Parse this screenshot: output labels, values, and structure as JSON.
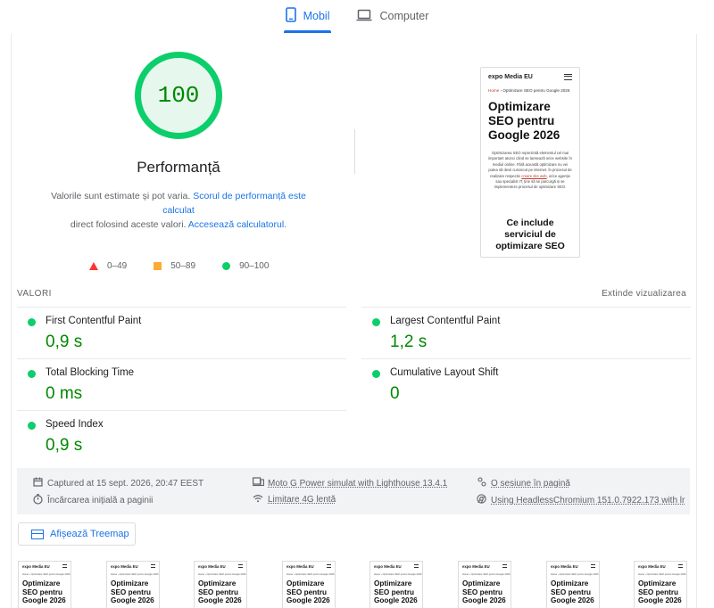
{
  "tabs": [
    {
      "label": "Mobil",
      "icon": "phone-icon",
      "active": true
    },
    {
      "label": "Computer",
      "icon": "laptop-icon",
      "active": false
    }
  ],
  "gauge": {
    "score": "100",
    "title": "Performanță",
    "note_prefix": "Valorile sunt estimate și pot varia.",
    "note_link1": "Scorul de performanță este calculat",
    "note_mid": "direct folosind aceste valori.",
    "note_link2": "Accesează calculatorul."
  },
  "legend": [
    {
      "range": "0–49",
      "shape": "triangle",
      "color": "#ff3333"
    },
    {
      "range": "50–89",
      "shape": "square",
      "color": "#ffaa33"
    },
    {
      "range": "90–100",
      "shape": "circle",
      "color": "#0cce6b"
    }
  ],
  "screenshot": {
    "site": "expo Media EU",
    "crumb_home": "Home",
    "crumb_rest": " › Optimizare SEO pentru Google 2026",
    "title": "Optimizare SEO pentru Google 2026",
    "body_a": "Optimizarea SEO reprezintă elementul cel mai important atunci când se lansează orice website în mediul online. Fără această optimizare nu vei putea să devii cunoscut pe internet. În procesul de realizare respectiv",
    "body_link": "creare site web",
    "body_b": ", orice agenție sau specialist IT, ține să se parcurgă și se implementeze procesul de optimizare SEO.",
    "h2": "Ce include serviciul de optimizare SEO"
  },
  "metrics": {
    "title": "VALORI",
    "expand": "Extinde vizualizarea",
    "fcp": {
      "label": "First Contentful Paint",
      "value": "0,9 s"
    },
    "lcp": {
      "label": "Largest Contentful Paint",
      "value": "1,2 s"
    },
    "tbt": {
      "label": "Total Blocking Time",
      "value": "0 ms"
    },
    "cls": {
      "label": "Cumulative Layout Shift",
      "value": "0"
    },
    "si": {
      "label": "Speed Index",
      "value": "0,9 s"
    }
  },
  "info": {
    "captured": "Captured at 15 sept. 2026, 20:47 EEST",
    "initial_load": "Încărcarea inițială a paginii",
    "device": "Moto G Power simulat with Lighthouse 13.4.1",
    "throttling": "Limitare 4G lentă",
    "session": "O sesiune în pagină",
    "browser": "Using HeadlessChromium 151.0.7922.173 with lr"
  },
  "treemap": {
    "label": "Afișează Treemap"
  },
  "filmstrip": {
    "site": "expo Media EU",
    "crumb": "Home › Optimizare SEO pentru Google 2026",
    "title": "Optimizare SEO pentru Google 2026",
    "frames": 8
  },
  "colors": {
    "accent": "#1a73e8",
    "pass": "#0cce6b",
    "pass_text": "#008800"
  }
}
